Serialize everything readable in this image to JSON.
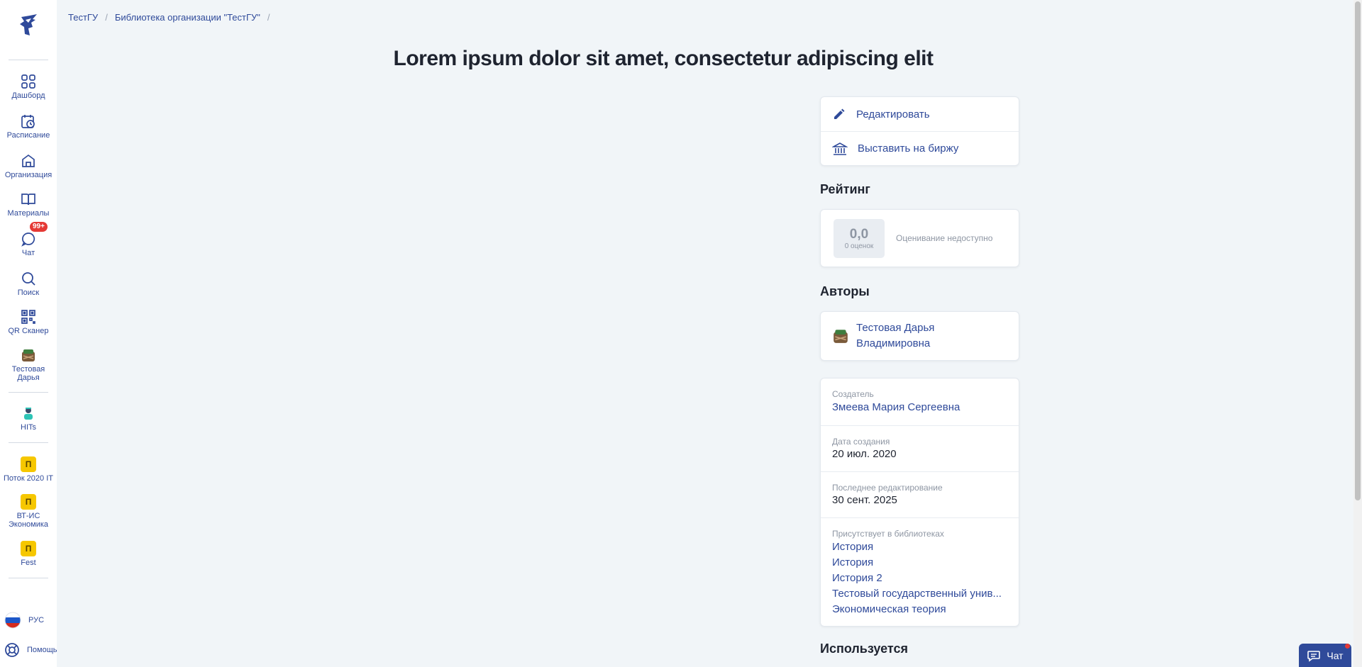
{
  "sidebar": {
    "items": [
      {
        "label": "Дашборд",
        "icon": "dashboard-icon"
      },
      {
        "label": "Расписание",
        "icon": "calendar-icon"
      },
      {
        "label": "Организация",
        "icon": "organization-icon"
      },
      {
        "label": "Материалы",
        "icon": "book-icon"
      },
      {
        "label": "Чат",
        "icon": "chat-icon",
        "badge": "99+"
      },
      {
        "label": "Поиск",
        "icon": "search-icon"
      },
      {
        "label": "QR Сканер",
        "icon": "qr-icon"
      },
      {
        "label": "Тестовая Дарья",
        "icon": "user-avatar"
      },
      {
        "label": "HITs",
        "icon": "hits-icon"
      },
      {
        "label": "Поток 2020 IT",
        "letter": "П"
      },
      {
        "label": "ВТ-ИС Экономика",
        "letter": "П"
      },
      {
        "label": "Fest",
        "letter": "П"
      }
    ],
    "language": "РУС",
    "help": "Помощь"
  },
  "breadcrumb": [
    "ТестГУ",
    "Библиотека организации \"ТестГУ\""
  ],
  "page_title": "Lorem ipsum dolor sit amet, consectetur adipiscing elit",
  "actions": {
    "edit": "Редактировать",
    "publish": "Выставить на биржу"
  },
  "rating": {
    "title": "Рейтинг",
    "value": "0,0",
    "count": "0 оценок",
    "status": "Оценивание недоступно"
  },
  "authors": {
    "title": "Авторы",
    "items": [
      "Тестовая Дарья Владимировна"
    ]
  },
  "info": {
    "creator_label": "Создатель",
    "creator": "Змеева Мария Сергеевна",
    "created_label": "Дата создания",
    "created": "20 июл. 2020",
    "edited_label": "Последнее редактирование",
    "edited": "30 сент. 2025",
    "libraries_label": "Присутствует в библиотеках",
    "libraries": [
      "История",
      "История",
      "История 2",
      "Тестовый государственный унив...",
      "Экономическая теория"
    ]
  },
  "used_title": "Используется",
  "chat_button": "Чат",
  "colors": {
    "accent": "#2f4a9a",
    "badge": "#e53935",
    "tile": "#f6c700"
  }
}
